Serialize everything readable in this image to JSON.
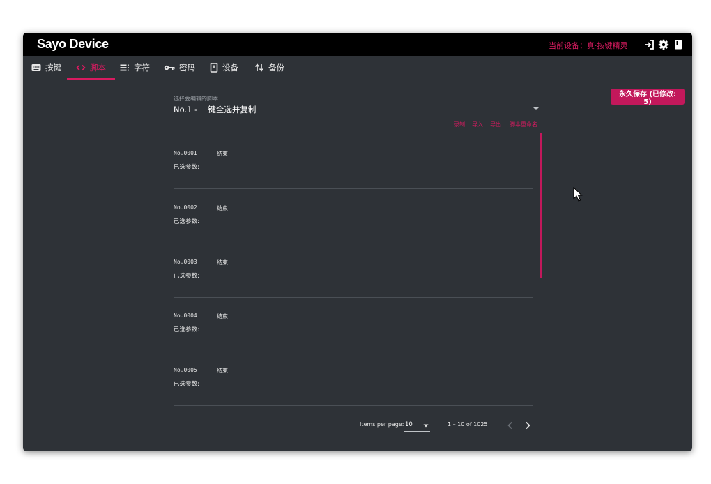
{
  "app": {
    "title": "Sayo Device",
    "device_label": "当前设备：真·按键精灵",
    "accent_color": "#d81b60",
    "toolbar_icons": [
      "login-icon",
      "gear-icon",
      "book-icon"
    ]
  },
  "tabs": [
    {
      "label": "按键",
      "icon": "keyboard-icon",
      "active": false
    },
    {
      "label": "脚本",
      "icon": "code-icon",
      "active": true
    },
    {
      "label": "字符",
      "icon": "text-lines-icon",
      "active": false
    },
    {
      "label": "密码",
      "icon": "key-icon",
      "active": false
    },
    {
      "label": "设备",
      "icon": "device-icon",
      "active": false
    },
    {
      "label": "备份",
      "icon": "swap-vert-icon",
      "active": false
    }
  ],
  "save_button": {
    "label": "永久保存 (已修改: 5)"
  },
  "script_select": {
    "label": "选择要编辑的脚本",
    "value": "No.1 - 一键全选并复制"
  },
  "actions": [
    "录制",
    "导入",
    "导出",
    "脚本重命名"
  ],
  "steps": [
    {
      "no": "No.0001",
      "action": "结束",
      "params_label": "已选参数:"
    },
    {
      "no": "No.0002",
      "action": "结束",
      "params_label": "已选参数:"
    },
    {
      "no": "No.0003",
      "action": "结束",
      "params_label": "已选参数:"
    },
    {
      "no": "No.0004",
      "action": "结束",
      "params_label": "已选参数:"
    },
    {
      "no": "No.0005",
      "action": "结束",
      "params_label": "已选参数:"
    }
  ],
  "paginator": {
    "items_per_page_label": "Items per page:",
    "page_size": "10",
    "range_label": "1 – 10 of 1025"
  }
}
